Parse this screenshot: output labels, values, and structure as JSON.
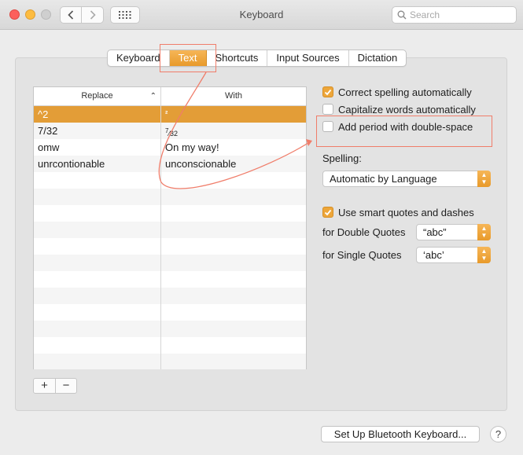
{
  "window": {
    "title": "Keyboard",
    "search_placeholder": "Search"
  },
  "tabs": [
    {
      "label": "Keyboard",
      "active": false
    },
    {
      "label": "Text",
      "active": true
    },
    {
      "label": "Shortcuts",
      "active": false
    },
    {
      "label": "Input Sources",
      "active": false
    },
    {
      "label": "Dictation",
      "active": false
    }
  ],
  "table": {
    "headers": {
      "replace": "Replace",
      "with": "With"
    },
    "rows": [
      {
        "replace": "^2",
        "with": "²",
        "selected": true
      },
      {
        "replace": "7/32",
        "with_num": "7",
        "with_den": "32",
        "selected": false
      },
      {
        "replace": "omw",
        "with": "On my way!",
        "selected": false
      },
      {
        "replace": "unrcontionable",
        "with": "unconscionable",
        "selected": false
      }
    ],
    "add_label": "+",
    "remove_label": "−"
  },
  "options": {
    "correct_spelling": {
      "label": "Correct spelling automatically",
      "checked": true
    },
    "capitalize_words": {
      "label": "Capitalize words automatically",
      "checked": false
    },
    "add_period": {
      "label": "Add period with double-space",
      "checked": false
    },
    "spelling_label": "Spelling:",
    "spelling_value": "Automatic by Language",
    "smart_quotes": {
      "label": "Use smart quotes and dashes",
      "checked": true
    },
    "double_quotes_label": "for Double Quotes",
    "double_quotes_value": "“abc”",
    "single_quotes_label": "for Single Quotes",
    "single_quotes_value": "‘abc’"
  },
  "footer": {
    "bluetooth_button": "Set Up Bluetooth Keyboard...",
    "help_label": "?"
  },
  "colors": {
    "accent": "#e89a2a",
    "annotation": "#f07d6a"
  }
}
